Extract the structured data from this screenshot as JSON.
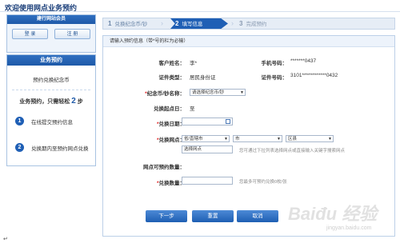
{
  "page_title": "欢迎使用网点业务预约",
  "login": {
    "header": "建行网站会员",
    "login_button": "登 录",
    "register_button": "注 册"
  },
  "business": {
    "header": "业务预约",
    "subtitle": "预约兑换纪念币",
    "steps_prefix": "业务预约，只需轻松",
    "steps_count": "2",
    "steps_suffix": "步",
    "step1_num": "1",
    "step1": "在线提交预约信息",
    "step2_num": "2",
    "step2": "兑换期内至预约网点兑换"
  },
  "progress": {
    "step1_num": "1",
    "step1": "兑换纪念币/钞",
    "step2_num": "2",
    "step2": "填写信息",
    "step3_num": "3",
    "step3": "完成预约"
  },
  "form": {
    "header": "请输入预约信息（带*号的栏为必输）",
    "customer_name_label": "客户姓名：",
    "customer_name_value": "李*",
    "phone_label": "手机号码：",
    "phone_value": "*******0437",
    "id_type_label": "证件类型：",
    "id_type_value": "居民身份证",
    "id_number_label": "证件号码：",
    "id_number_value": "3101************0432",
    "coin_label": "纪念币/钞名称：",
    "coin_select": "请选择纪念币/钞",
    "start_date_label": "兑换起点日：",
    "start_date_value": "至",
    "exchange_date_label": "兑换日期：",
    "exchange_date_value": "",
    "outlet_label": "兑换网点：",
    "province_select": "省/直辖市",
    "city_select": "市",
    "district_select": "区县",
    "outlet_select": "选择网点",
    "outlet_hint": "您可通过下拉列表选择网点或直接输入关键字搜索网点",
    "available_label": "网点可预约数量：",
    "quantity_label": "兑换数量：",
    "quantity_value": "",
    "quantity_hint": "您最多可预约兑换0枚/张",
    "required_mark": "*"
  },
  "buttons": {
    "next": "下一步",
    "reset": "重置",
    "cancel": "取消"
  },
  "watermark": {
    "text": "Baiđu 经验",
    "sub": "jingyan.baidu.com"
  }
}
